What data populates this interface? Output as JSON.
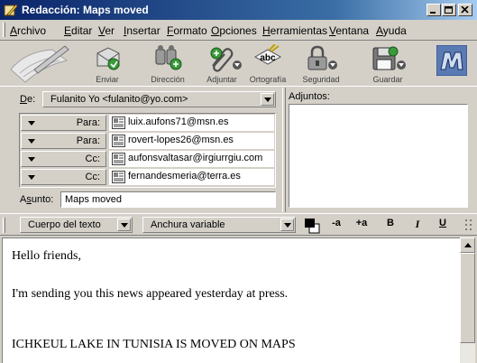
{
  "window": {
    "title": "Redacción: Maps moved"
  },
  "menu": {
    "items": [
      {
        "first": "A",
        "rest": "rchivo"
      },
      {
        "first": "E",
        "rest": "ditar"
      },
      {
        "first": "V",
        "rest": "er"
      },
      {
        "first": "I",
        "rest": "nsertar"
      },
      {
        "first": "F",
        "rest": "ormato"
      },
      {
        "first": "O",
        "rest": "pciones"
      },
      {
        "first": "H",
        "rest": "erramientas"
      },
      {
        "first": "V",
        "rest": "entana"
      },
      {
        "first": "A",
        "rest": "yuda"
      }
    ]
  },
  "toolbar": {
    "send": "Enviar",
    "address": "Dirección",
    "attach": "Adjuntar",
    "spell": "Ortografía",
    "security": "Seguridad",
    "save": "Guardar",
    "spell_icon_text": "abc"
  },
  "header": {
    "from_label": "De:",
    "from_label_first": "D",
    "from_label_rest": "e:",
    "from_value": "Fulanito Yo <fulanito@yo.com>",
    "recipients": [
      {
        "type": "Para:",
        "address": "luix.aufons71@msn.es"
      },
      {
        "type": "Para:",
        "address": "rovert-lopes26@msn.es"
      },
      {
        "type": "Cc:",
        "address": "aufonsvaltasar@irgiurrgiu.com"
      },
      {
        "type": "Cc:",
        "address": "fernandesmeria@terra.es"
      }
    ],
    "subject_label_first": "A",
    "subject_label_mid": "s",
    "subject_label_rest": "unto:",
    "subject_value": "Maps moved",
    "attachments_label": "Adjuntos:"
  },
  "format": {
    "paragraph_style": "Cuerpo del texto",
    "font": "Anchura variable",
    "smaller": "-a",
    "larger": "+a",
    "bold": "B",
    "italic": "I",
    "underline": "U"
  },
  "body": {
    "lines": [
      "Hello friends,",
      "I'm sending you this news appeared yesterday at press.",
      "ICHKEUL LAKE IN TUNISIA IS MOVED ON MAPS"
    ]
  },
  "colors": {
    "title_gradient_start": "#0a246a",
    "title_gradient_end": "#a6caf0",
    "chrome": "#d4d0c8"
  }
}
